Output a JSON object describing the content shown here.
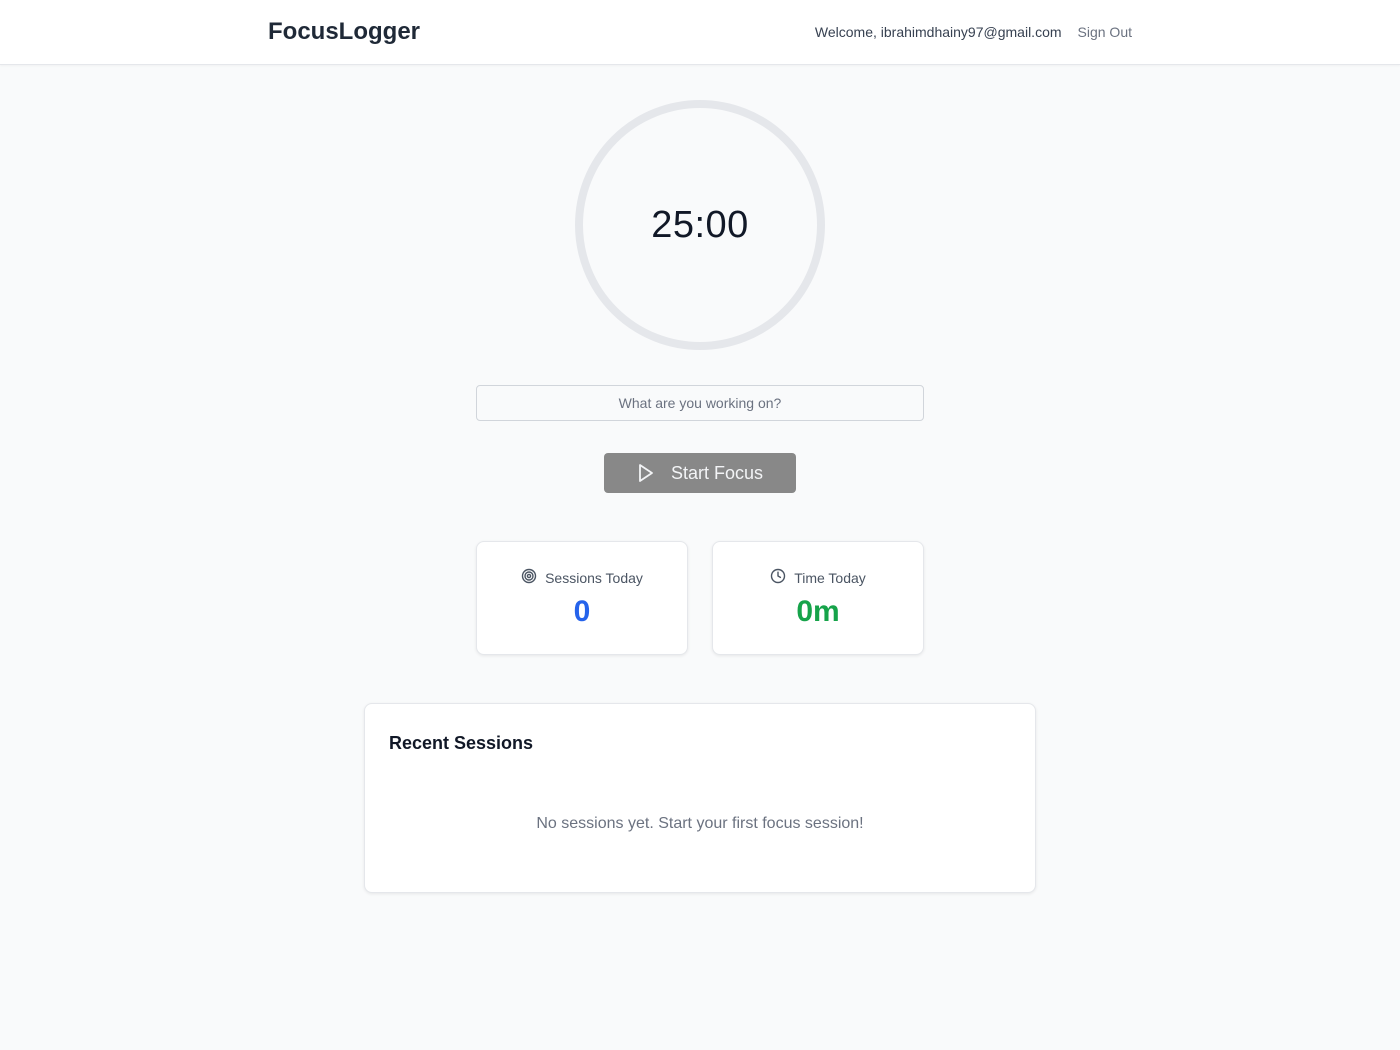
{
  "header": {
    "logo": "FocusLogger",
    "welcome": "Welcome, ibrahimdhainy97@gmail.com",
    "sign_out": "Sign Out"
  },
  "timer": {
    "display": "25:00"
  },
  "task": {
    "placeholder": "What are you working on?",
    "value": ""
  },
  "start_button": {
    "label": "Start Focus",
    "icon": "play-icon"
  },
  "stats": {
    "sessions": {
      "label": "Sessions Today",
      "value": "0",
      "icon": "target-icon",
      "color": "#2563eb"
    },
    "time": {
      "label": "Time Today",
      "value": "0m",
      "icon": "clock-icon",
      "color": "#16a34a"
    }
  },
  "recent": {
    "title": "Recent Sessions",
    "empty": "No sessions yet. Start your first focus session!"
  }
}
